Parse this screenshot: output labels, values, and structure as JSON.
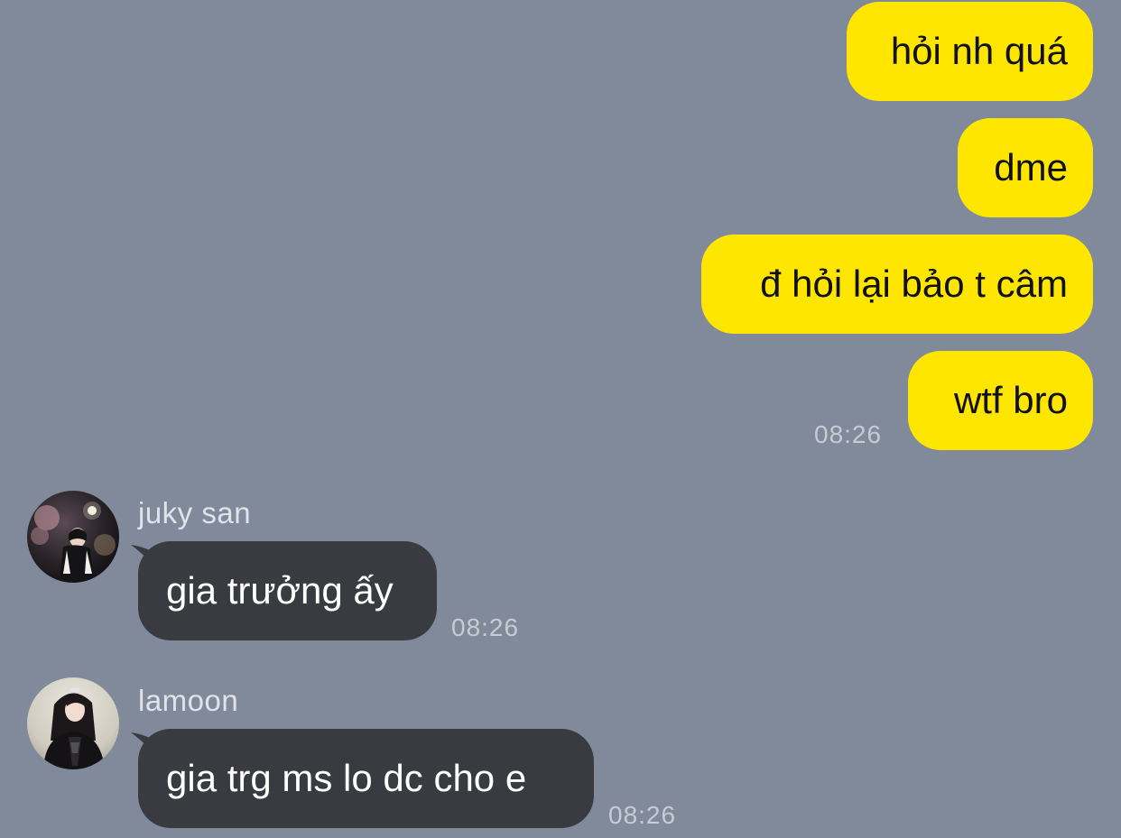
{
  "theme": {
    "background": "#808a9a",
    "outgoing_bubble": "#ffe600",
    "incoming_bubble": "#3a3b40",
    "timestamp_color": "#c6cbd4"
  },
  "outgoing_messages": [
    {
      "text": "hỏi nh quá"
    },
    {
      "text": "dme"
    },
    {
      "text": "đ hỏi lại bảo t câm"
    },
    {
      "text": "wtf bro"
    }
  ],
  "outgoing_timestamp": "08:26",
  "incoming_messages": [
    {
      "sender": "juky san",
      "text": "gia trưởng ấy",
      "time": "08:26",
      "avatar": "user-avatar-photo"
    },
    {
      "sender": "lamoon",
      "text": "gia trg ms lo dc cho e",
      "time": "08:26",
      "avatar": "user-avatar-photo"
    }
  ]
}
